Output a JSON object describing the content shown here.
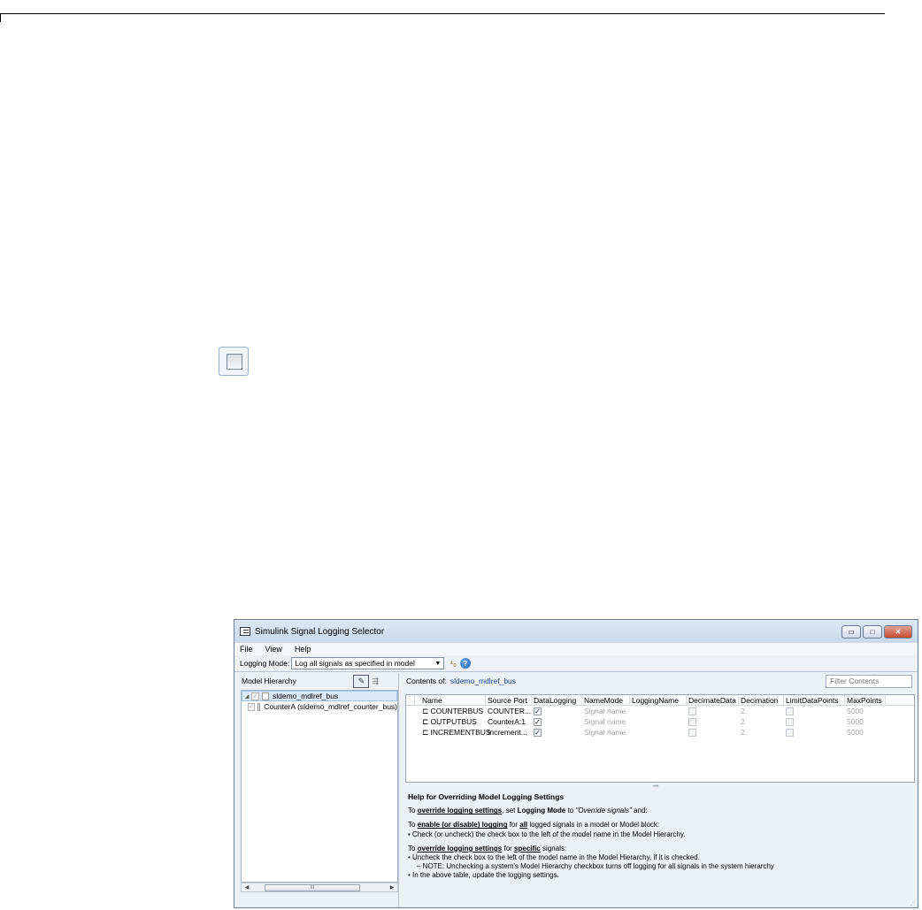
{
  "window": {
    "title": "Simulink Signal Logging Selector",
    "controls": {
      "minimize": "▭",
      "maximize": "□",
      "close": "✕"
    }
  },
  "menu": [
    "File",
    "View",
    "Help"
  ],
  "toolbar": {
    "logging_mode_label": "Logging Mode:",
    "logging_mode_value": "Log all signals as specified in model"
  },
  "left_panel": {
    "title": "Model Hierarchy",
    "tree": [
      {
        "label": "sldemo_mdlref_bus",
        "selected": true
      },
      {
        "label": "CounterA (sldemo_mdlref_counter_bus)",
        "selected": false
      }
    ],
    "scroll_thumb": "III"
  },
  "right_panel": {
    "contents_label": "Contents of:",
    "contents_model": "sldemo_mdlref_bus",
    "filter_placeholder": "Filter Contents",
    "columns": [
      "Name",
      "Source Port",
      "DataLogging",
      "NameMode",
      "LoggingName",
      "DecimateData",
      "Decimation",
      "LimitDataPoints",
      "MaxPoints"
    ],
    "rows": [
      {
        "name": "COUNTERBUS",
        "source_port": "COUNTER...",
        "name_mode": "Signal name",
        "decimation": "2",
        "max_points": "5000"
      },
      {
        "name": "OUTPUTBUS",
        "source_port": "CounterA:1",
        "name_mode": "Signal name",
        "decimation": "2",
        "max_points": "5000"
      },
      {
        "name": "INCREMENTBUS",
        "source_port": "Increment...",
        "name_mode": "Signal name",
        "decimation": "2",
        "max_points": "5000"
      }
    ]
  },
  "help": {
    "title": "Help for Overriding Model Logging Settings",
    "line1_pre": "To ",
    "line1_bold": "override logging settings",
    "line1_mid": ", set ",
    "line1_bold2": "Logging Mode",
    "line1_mid2": " to ",
    "line1_italic": "\"Override signals\"",
    "line1_post": " and:",
    "line2_pre": "To ",
    "line2_bold": "enable (or disable) logging",
    "line2_mid": " for ",
    "line2_bold2": "all",
    "line2_post": " logged signals in a model or Model block:",
    "line3": "• Check (or uncheck) the check box to the left of the model name in the Model Hierarchy.",
    "line4_pre": "To ",
    "line4_bold": "override logging settings",
    "line4_mid": " for ",
    "line4_bold2": "specific",
    "line4_post": " signals:",
    "line5": "• Uncheck the check box to the left of the model name in the Model Hierarchy, if it is checked.",
    "line6": "– NOTE: Unchecking a system's Model Hierarchy checkbox turns off logging for all signals in the system hierarchy",
    "line7": "• In the above table, update the logging settings."
  }
}
